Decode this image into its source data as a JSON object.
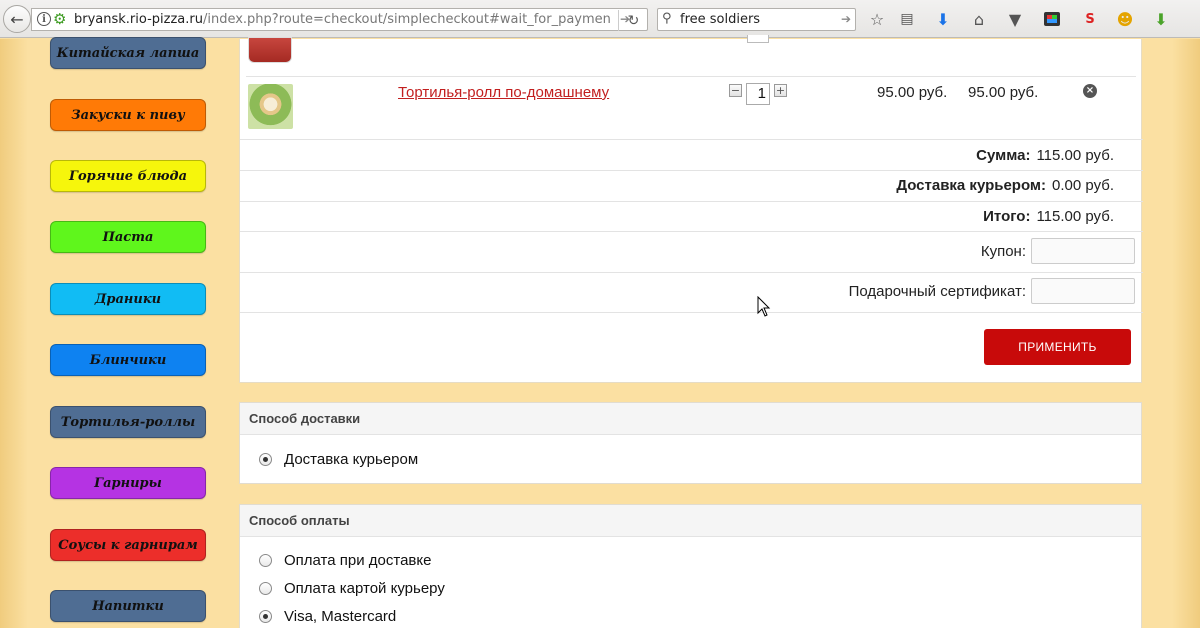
{
  "browser": {
    "back_icon": "back-arrow-icon",
    "url_host": "bryansk.rio-pizza.ru",
    "url_path": "/index.php?route=checkout/simplecheckout#wait_for_paymen",
    "search_value": "free soldiers",
    "toolbar_icons": [
      "bookmark-star-icon",
      "reading-list-icon",
      "download-icon",
      "home-icon",
      "pocket-icon",
      "screenshot-icon",
      "seo-extension-icon",
      "chrome-extension-icon",
      "green-download-icon"
    ]
  },
  "sidebar": {
    "categories": [
      {
        "label": "Китайская лапша",
        "color": "#4f6d93"
      },
      {
        "label": "Закуски к пиву",
        "color": "#ff7a06"
      },
      {
        "label": "Горячие блюда",
        "color": "#f6f60c"
      },
      {
        "label": "Паста",
        "color": "#5ff61c"
      },
      {
        "label": "Драники",
        "color": "#11bcf4"
      },
      {
        "label": "Блинчики",
        "color": "#0e82f1"
      },
      {
        "label": "Тортилья-роллы",
        "color": "#4f6d93"
      },
      {
        "label": "Гарниры",
        "color": "#b533e3"
      },
      {
        "label": "Соусы к гарнирам",
        "color": "#ec2e2a"
      },
      {
        "label": "Напитки",
        "color": "#4f6d93"
      }
    ]
  },
  "cart": {
    "item": {
      "name": "Тортилья-ролл по-домашнему",
      "quantity": "1",
      "price": "95.00 руб.",
      "total": "95.00 руб."
    },
    "totals": [
      {
        "label": "Сумма:",
        "value": "115.00 руб."
      },
      {
        "label": "Доставка курьером:",
        "value": "0.00 руб."
      },
      {
        "label": "Итого:",
        "value": "115.00 руб."
      }
    ],
    "coupon_label": "Купон:",
    "gift_label": "Подарочный сертификат:",
    "apply_label": "ПРИМЕНИТЬ",
    "accent_color": "#c80a0a"
  },
  "shipping": {
    "title": "Способ доставки",
    "options": [
      {
        "label": "Доставка курьером",
        "checked": true
      }
    ]
  },
  "payment": {
    "title": "Способ оплаты",
    "options": [
      {
        "label": "Оплата при доставке",
        "checked": false
      },
      {
        "label": "Оплата картой курьеру",
        "checked": false
      },
      {
        "label": "Visa, Mastercard",
        "checked": true
      }
    ]
  }
}
